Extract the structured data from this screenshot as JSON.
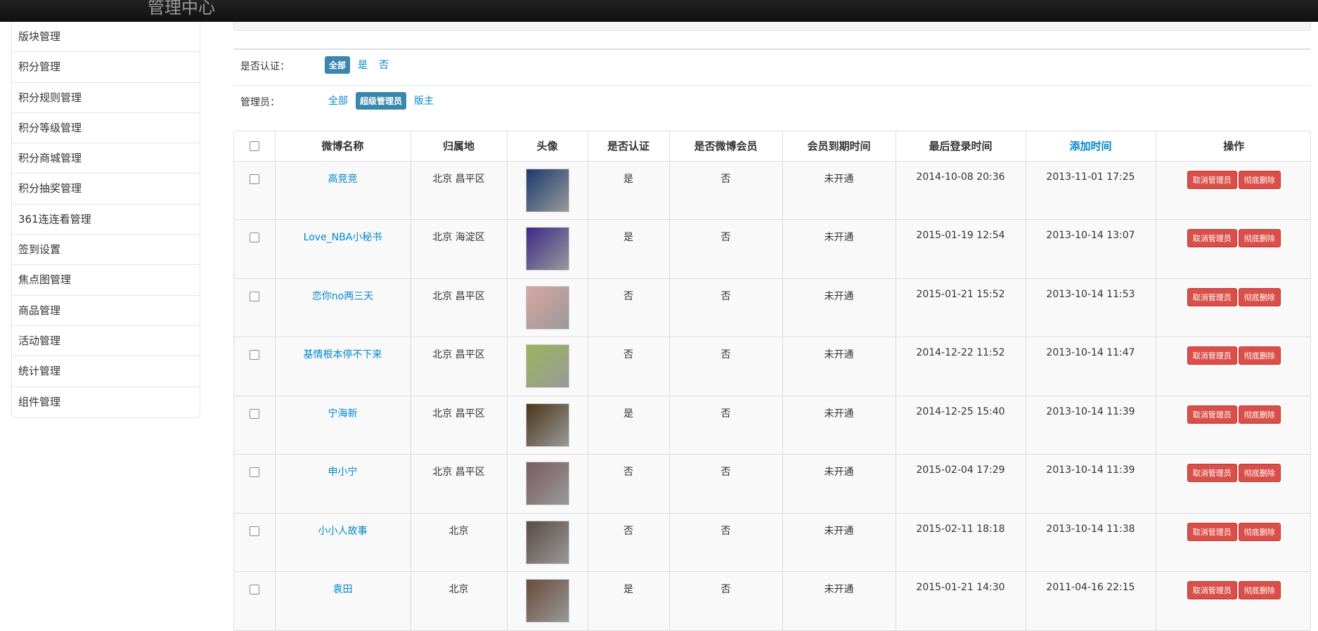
{
  "header": {
    "title": "管理中心"
  },
  "sidebar": {
    "items": [
      {
        "label": "版块管理"
      },
      {
        "label": "积分管理"
      },
      {
        "label": "积分规则管理"
      },
      {
        "label": "积分等级管理"
      },
      {
        "label": "积分商城管理"
      },
      {
        "label": "积分抽奖管理"
      },
      {
        "label": "361连连看管理"
      },
      {
        "label": "签到设置"
      },
      {
        "label": "焦点图管理"
      },
      {
        "label": "商品管理"
      },
      {
        "label": "活动管理"
      },
      {
        "label": "统计管理"
      },
      {
        "label": "组件管理"
      }
    ]
  },
  "filters": {
    "verified": {
      "label": "是否认证：",
      "options": [
        {
          "label": "全部",
          "active": true
        },
        {
          "label": "是"
        },
        {
          "label": "否"
        }
      ]
    },
    "admin": {
      "label": "管理员：",
      "options": [
        {
          "label": "全部"
        },
        {
          "label": "超级管理员",
          "active": true
        },
        {
          "label": "版主"
        }
      ]
    }
  },
  "table": {
    "columns": [
      "微博名称",
      "归属地",
      "头像",
      "是否认证",
      "是否微博会员",
      "会员到期时间",
      "最后登录时间",
      "添加时间",
      "操作"
    ],
    "action_labels": {
      "cancel_admin": "取消管理员",
      "delete": "彻底删除"
    },
    "rows": [
      {
        "name": "高竞竞",
        "location": "北京 昌平区",
        "verified": "是",
        "vip": "否",
        "vip_expire": "未开通",
        "last_login": "2014-10-08 20:36",
        "added": "2013-11-01 17:25",
        "avatar_color": "#1a3b6e"
      },
      {
        "name": "Love_NBA小秘书",
        "location": "北京 海淀区",
        "verified": "是",
        "vip": "否",
        "vip_expire": "未开通",
        "last_login": "2015-01-19 12:54",
        "added": "2013-10-14 13:07",
        "avatar_color": "#3b2a8a"
      },
      {
        "name": "恋你no两三天",
        "location": "北京 昌平区",
        "verified": "否",
        "vip": "否",
        "vip_expire": "未开通",
        "last_login": "2015-01-21 15:52",
        "added": "2013-10-14 11:53",
        "avatar_color": "#d9a6a0"
      },
      {
        "name": "基情根本停不下来",
        "location": "北京 昌平区",
        "verified": "否",
        "vip": "否",
        "vip_expire": "未开通",
        "last_login": "2014-12-22 11:52",
        "added": "2013-10-14 11:47",
        "avatar_color": "#9bb65a"
      },
      {
        "name": "宁海新",
        "location": "北京 昌平区",
        "verified": "是",
        "vip": "否",
        "vip_expire": "未开通",
        "last_login": "2014-12-25 15:40",
        "added": "2013-10-14 11:39",
        "avatar_color": "#4a3618"
      },
      {
        "name": "申小宁",
        "location": "北京 昌平区",
        "verified": "否",
        "vip": "否",
        "vip_expire": "未开通",
        "last_login": "2015-02-04 17:29",
        "added": "2013-10-14 11:39",
        "avatar_color": "#7a5a60"
      },
      {
        "name": "小小人故事",
        "location": "北京",
        "verified": "否",
        "vip": "否",
        "vip_expire": "未开通",
        "last_login": "2015-02-11 18:18",
        "added": "2013-10-14 11:38",
        "avatar_color": "#5a4b45"
      },
      {
        "name": "袁田",
        "location": "北京",
        "verified": "是",
        "vip": "否",
        "vip_expire": "未开通",
        "last_login": "2015-01-21 14:30",
        "added": "2011-04-16 22:15",
        "avatar_color": "#6a4a3a"
      }
    ]
  }
}
